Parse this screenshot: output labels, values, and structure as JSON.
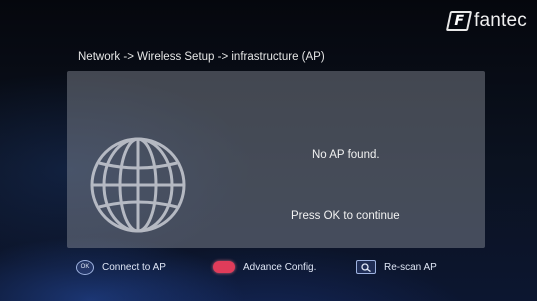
{
  "brand": {
    "name": "fantec",
    "mark": "F"
  },
  "breadcrumb": "Network -> Wireless Setup -> infrastructure (AP)",
  "dialog": {
    "message": "No AP found.",
    "prompt": "Press OK to continue"
  },
  "footer": {
    "connect": {
      "button": "OK",
      "label": "Connect to AP"
    },
    "advance": {
      "label": "Advance Config."
    },
    "rescan": {
      "label": "Re-scan AP"
    }
  },
  "colors": {
    "panel": "#969ba5",
    "red_button": "#e03c5a",
    "accent": "#9fb3e0"
  },
  "icons": [
    "globe-icon",
    "ok-button-icon",
    "red-button-icon",
    "rescan-icon"
  ]
}
